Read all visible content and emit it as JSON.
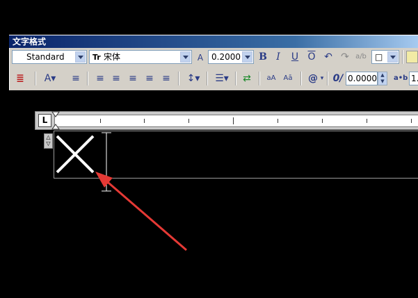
{
  "window": {
    "title": "文字格式"
  },
  "toolbar_row1": {
    "style": "Standard",
    "font": "宋体",
    "font_icon": "Tr",
    "height_value": "0.2000",
    "bold": "B",
    "italic": "I",
    "underline": "U",
    "overline": "O",
    "undo_icon": "undo-icon",
    "redo_icon": "redo-icon",
    "stack_icon": "stack-fraction-icon",
    "color_box": "□",
    "ok_icon": "ok-icon"
  },
  "toolbar_row2": {
    "oblique_value": "0.0000",
    "oblique_label": "0/",
    "tracking_label": "a•b",
    "tracking_value": "1.",
    "symbol": "@",
    "uppercase": "aA",
    "lowercase": "Aā"
  },
  "ruler": {
    "tab_button": "L"
  },
  "resize_handle": {
    "up": "△",
    "down": "▽"
  },
  "colors": {
    "accent": "#0a246a",
    "arrow": "#e53935"
  }
}
